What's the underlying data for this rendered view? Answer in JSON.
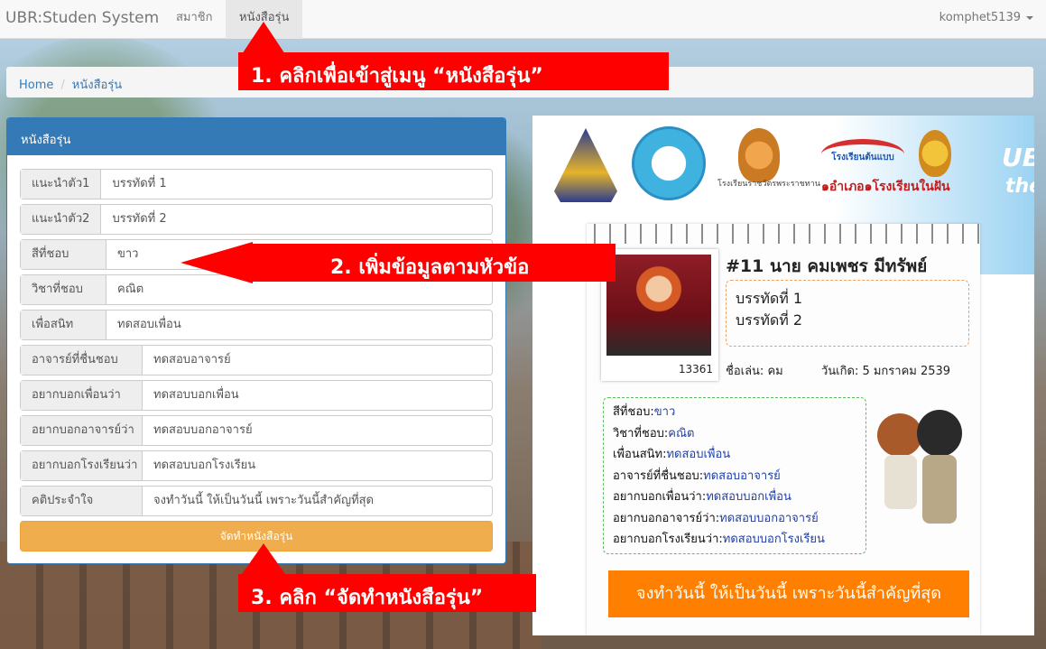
{
  "navbar": {
    "brand": "UBR:Studen System",
    "items": [
      {
        "label": "สมาชิก",
        "active": false
      },
      {
        "label": "หนังสือรุ่น",
        "active": true
      }
    ],
    "user": "komphet5139"
  },
  "breadcrumb": {
    "home": "Home",
    "current": "หนังสือรุ่น"
  },
  "form": {
    "title": "หนังสือรุ่น",
    "fields": [
      {
        "label": "แนะนำตัว1",
        "value": "บรรทัดที่ 1"
      },
      {
        "label": "แนะนำตัว2",
        "value": "บรรทัดที่ 2"
      },
      {
        "label": "สีที่ชอบ",
        "value": "ขาว"
      },
      {
        "label": "วิชาที่ชอบ",
        "value": "คณิต"
      },
      {
        "label": "เพื่อสนิท",
        "value": "ทดสอบเพื่อน"
      },
      {
        "label": "อาจารย์ที่ชื่นชอบ",
        "value": "ทดสอบอาจารย์"
      },
      {
        "label": "อยากบอกเพื่อนว่า",
        "value": "ทดสอบบอกเพื่อน"
      },
      {
        "label": "อยากบอกอาจารย์ว่า",
        "value": "ทดสอบบอกอาจารย์"
      },
      {
        "label": "อยากบอกโรงเรียนว่า",
        "value": "ทดสอบบอกโรงเรียน"
      },
      {
        "label": "คติประจำใจ",
        "value": "จงทำวันนี้ ให้เป็นวันนี้ เพราะวันนี้สำคัญที่สุด"
      }
    ],
    "submit_label": "จัดทำหนังสือรุ่น"
  },
  "preview": {
    "banner": {
      "logo4_text": "โรงเรียนต้นแบบ",
      "logo4_sub": "๑อำเภอ๑โรงเรียนในฝัน",
      "logo3_text": "โรงเรียนราชวัตรพระราชทาน",
      "title": "UBR",
      "subtitle": "the"
    },
    "photo_id": "13361",
    "name": "#11 นาย คมเพชร มีทรัพย์",
    "intro_line1": "บรรทัดที่ 1",
    "intro_line2": "บรรทัดที่ 2",
    "nickname": "ชื่อเล่น: คม",
    "birthday": "วันเกิด: 5 มกราคม 2539",
    "details": [
      {
        "label": "สีที่ชอบ:",
        "value": "ขาว"
      },
      {
        "label": "วิชาที่ชอบ:",
        "value": "คณิต"
      },
      {
        "label": "เพื่อนสนิท:",
        "value": "ทดสอบเพื่อน"
      },
      {
        "label": "อาจารย์ที่ชื่นชอบ:",
        "value": "ทดสอบอาจารย์"
      },
      {
        "label": "อยากบอกเพื่อนว่า:",
        "value": "ทดสอบบอกเพื่อน"
      },
      {
        "label": "อยากบอกอาจารย์ว่า:",
        "value": "ทดสอบบอกอาจารย์"
      },
      {
        "label": "อยากบอกโรงเรียนว่า:",
        "value": "ทดสอบบอกโรงเรียน"
      }
    ],
    "motto": "จงทำวันนี้ ให้เป็นวันนี้ เพราะวันนี้สำคัญที่สุด"
  },
  "callouts": {
    "step1": "1. คลิกเพื่อเข้าสู่เมนู “หนังสือรุ่น”",
    "step2": "2. เพิ่มข้อมูลตามหัวข้อ",
    "step3": "3. คลิก “จัดทำหนังสือรุ่น”"
  },
  "colors": {
    "primary": "#337ab7",
    "warning": "#f0ad4e",
    "callout": "#ff0000",
    "motto_bar": "#ff7f00"
  }
}
